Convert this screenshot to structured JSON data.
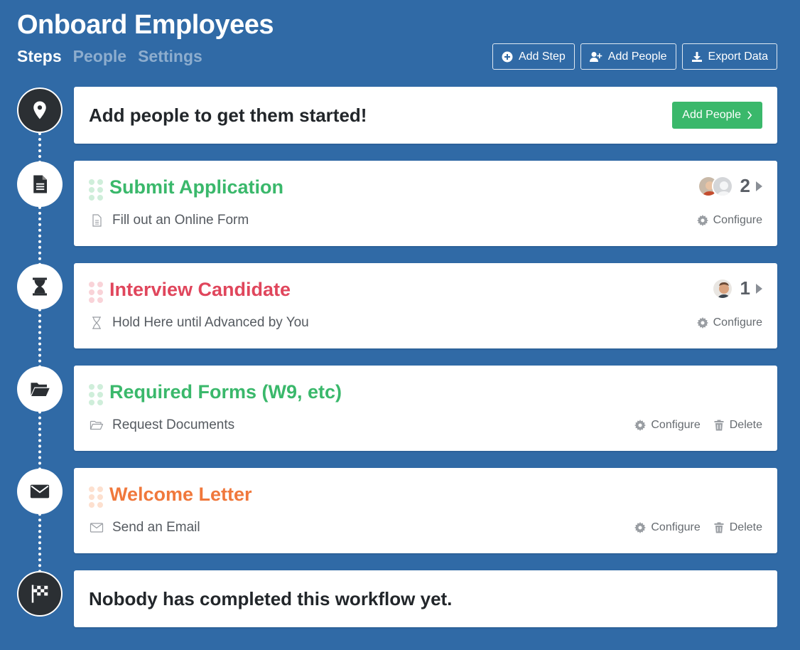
{
  "header": {
    "title": "Onboard Employees",
    "tabs": [
      {
        "label": "Steps",
        "active": true
      },
      {
        "label": "People",
        "active": false
      },
      {
        "label": "Settings",
        "active": false
      }
    ],
    "actions": [
      {
        "label": "Add Step",
        "icon": "plus-circle-icon"
      },
      {
        "label": "Add People",
        "icon": "add-user-icon"
      },
      {
        "label": "Export Data",
        "icon": "download-icon"
      }
    ]
  },
  "start": {
    "icon": "map-marker-icon",
    "text": "Add people to get them started!",
    "button_label": "Add People"
  },
  "steps": [
    {
      "title": "Submit Application",
      "title_color": "#3ab86b",
      "icon": "document-icon",
      "sub_icon": "document-outline-icon",
      "subtitle": "Fill out an Online Form",
      "count": "2",
      "configure": "Configure",
      "delete": null
    },
    {
      "title": "Interview Candidate",
      "title_color": "#e0465c",
      "icon": "hourglass-icon",
      "sub_icon": "hourglass-outline-icon",
      "subtitle": "Hold Here until Advanced by You",
      "count": "1",
      "configure": "Configure",
      "delete": null
    },
    {
      "title": "Required Forms (W9, etc)",
      "title_color": "#3ab86b",
      "icon": "folder-open-icon",
      "sub_icon": "folder-outline-icon",
      "subtitle": "Request Documents",
      "count": null,
      "configure": "Configure",
      "delete": "Delete"
    },
    {
      "title": "Welcome Letter",
      "title_color": "#f0783c",
      "icon": "envelope-icon",
      "sub_icon": "envelope-outline-icon",
      "subtitle": "Send an Email",
      "count": null,
      "configure": "Configure",
      "delete": "Delete"
    }
  ],
  "finish": {
    "icon": "checkered-flag-icon",
    "text": "Nobody has completed this workflow yet."
  },
  "colors": {
    "background": "#306aa6",
    "accent_green": "#3ab86b",
    "accent_red": "#e0465c",
    "accent_orange": "#f0783c"
  }
}
